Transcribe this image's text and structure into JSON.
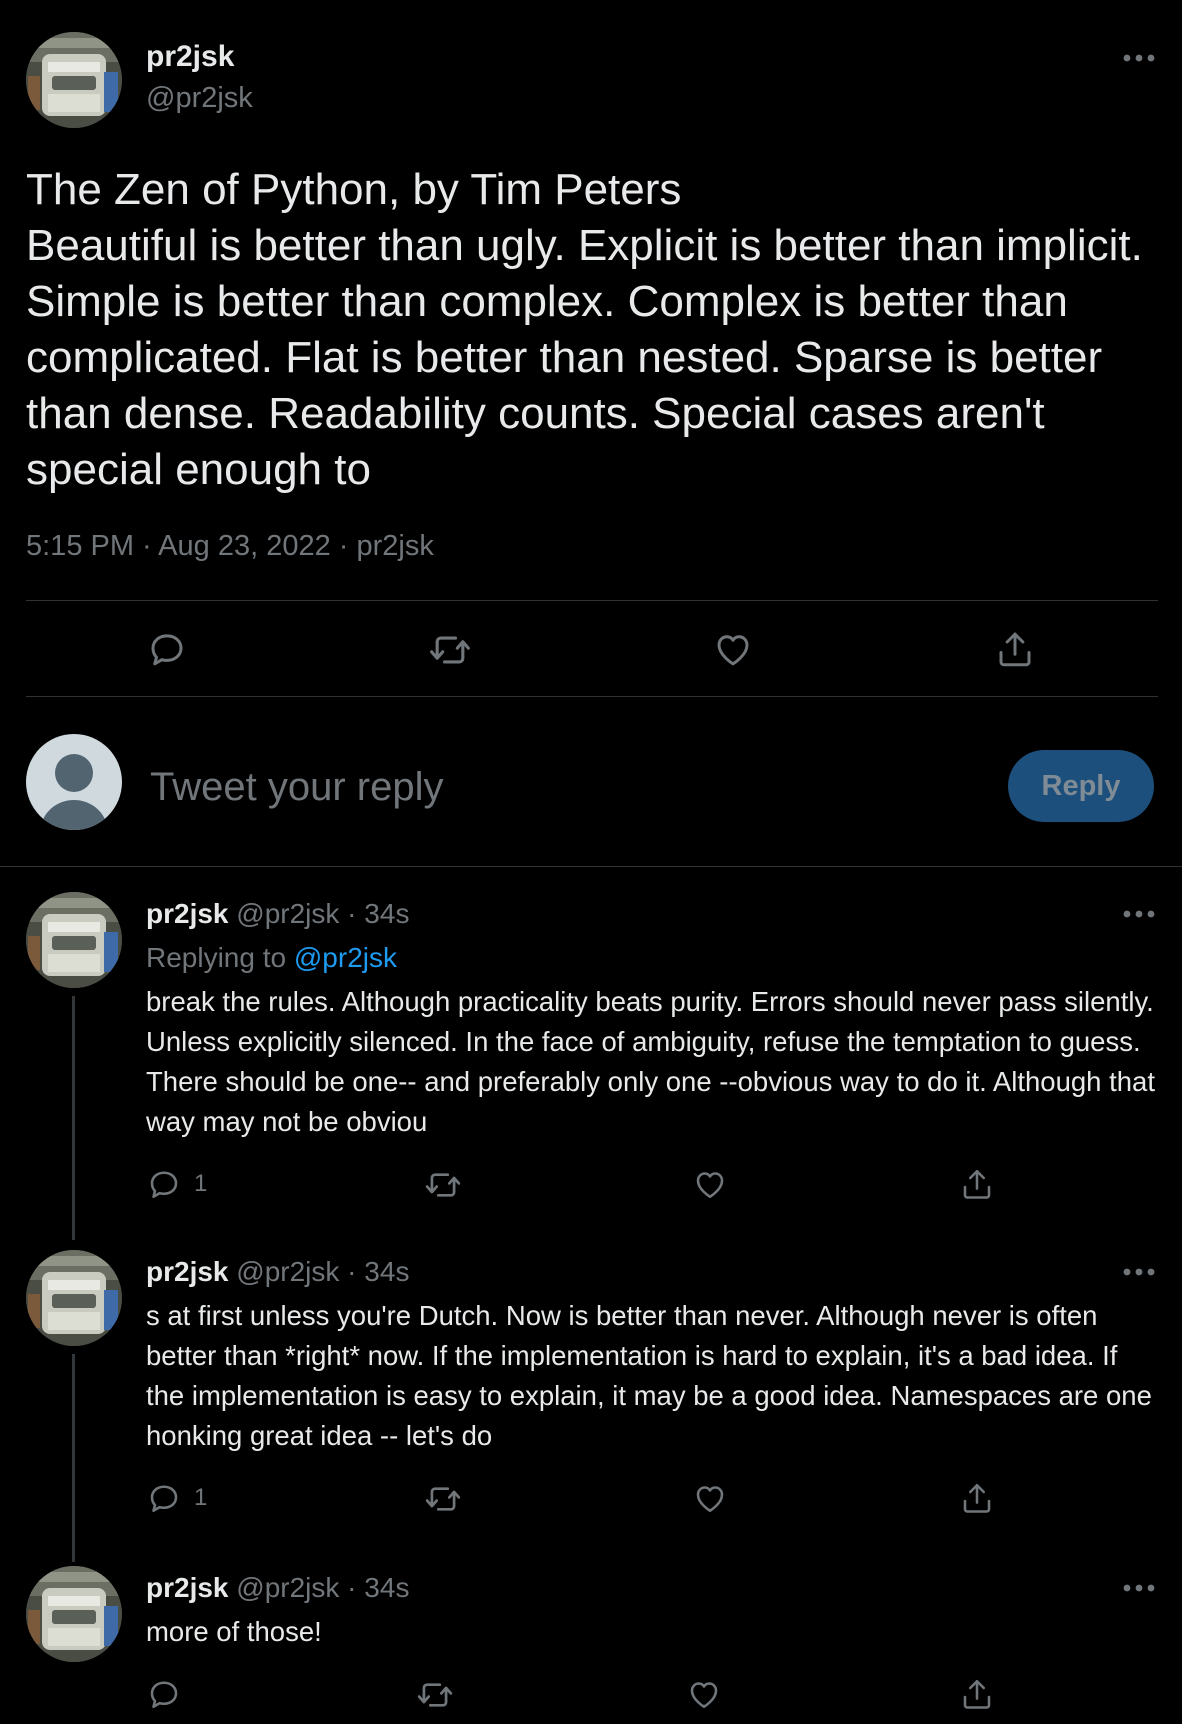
{
  "main_tweet": {
    "display_name": "pr2jsk",
    "handle": "@pr2jsk",
    "text": "The Zen of Python, by Tim Peters\nBeautiful is better than ugly. Explicit is better than implicit. Simple is better than complex. Complex is better than complicated. Flat is better than nested. Sparse is better than dense. Readability counts. Special cases aren't special enough to",
    "time": "5:15 PM",
    "date": "Aug 23, 2022",
    "source": "pr2jsk",
    "separator": " · ",
    "actions": [
      "reply-icon",
      "retweet-icon",
      "like-icon",
      "share-icon"
    ]
  },
  "composer": {
    "placeholder": "Tweet your reply",
    "button_label": "Reply"
  },
  "replies": [
    {
      "display_name": "pr2jsk",
      "handle": "@pr2jsk",
      "time": "34s",
      "replying_label": "Replying to",
      "replying_to": "@pr2jsk",
      "text": "break the rules. Although practicality beats purity. Errors should never pass silently. Unless explicitly silenced. In the face of ambiguity, refuse the temptation to guess. There should be one-- and preferably only one --obvious way to do it. Although that way may not be obviou",
      "reply_count": "1"
    },
    {
      "display_name": "pr2jsk",
      "handle": "@pr2jsk",
      "time": "34s",
      "text": "s at first unless you're Dutch. Now is better than never. Although never is often better than *right* now. If the implementation is hard to explain, it's a bad idea. If the implementation is easy to explain, it may be a good idea. Namespaces are one honking great idea -- let's do",
      "reply_count": "1"
    },
    {
      "display_name": "pr2jsk",
      "handle": "@pr2jsk",
      "time": "34s",
      "text": "more of those!",
      "reply_count": ""
    }
  ],
  "colors": {
    "background": "#000000",
    "text": "#e7e9ea",
    "muted": "#71767b",
    "link": "#1d9bf0",
    "divider": "#2f3336",
    "reply_button": "#1d4f7c"
  }
}
